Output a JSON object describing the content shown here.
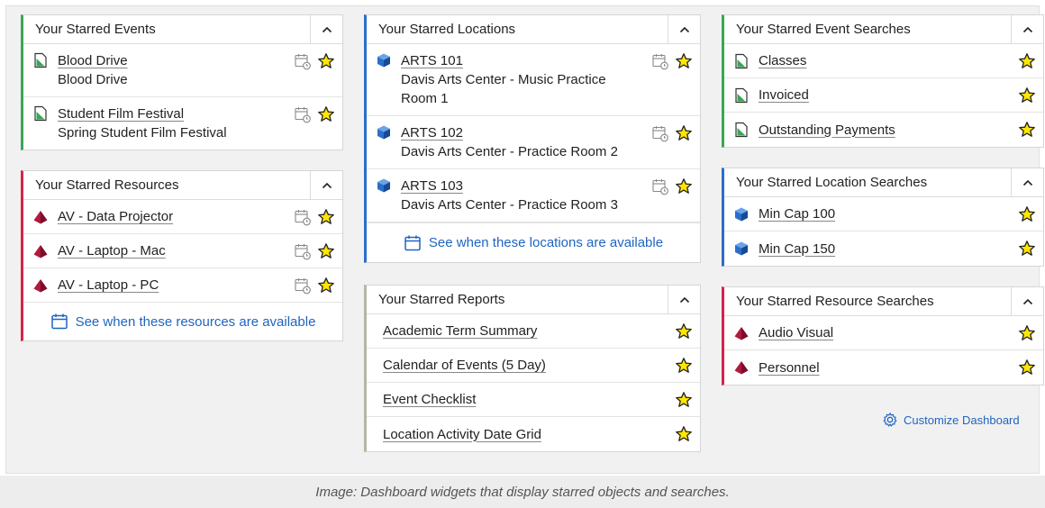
{
  "starred_events": {
    "title": "Your Starred Events",
    "items": [
      {
        "name": "Blood Drive",
        "sub": "Blood Drive"
      },
      {
        "name": "Student Film Festival",
        "sub": "Spring Student Film Festival"
      }
    ]
  },
  "starred_resources": {
    "title": "Your Starred Resources",
    "items": [
      {
        "name": "AV - Data Projector"
      },
      {
        "name": "AV - Laptop - Mac"
      },
      {
        "name": "AV - Laptop - PC"
      }
    ],
    "availability_link": "See when these resources are available"
  },
  "starred_locations": {
    "title": "Your Starred Locations",
    "items": [
      {
        "name": "ARTS 101",
        "sub": "Davis Arts Center - Music Practice Room 1"
      },
      {
        "name": "ARTS 102",
        "sub": "Davis Arts Center - Practice Room 2"
      },
      {
        "name": "ARTS 103",
        "sub": "Davis Arts Center - Practice Room 3"
      }
    ],
    "availability_link": "See when these locations are available"
  },
  "starred_reports": {
    "title": "Your Starred Reports",
    "items": [
      {
        "name": "Academic Term Summary"
      },
      {
        "name": "Calendar of Events (5 Day)"
      },
      {
        "name": "Event Checklist"
      },
      {
        "name": "Location Activity Date Grid"
      }
    ]
  },
  "starred_event_searches": {
    "title": "Your Starred Event Searches",
    "items": [
      {
        "name": "Classes"
      },
      {
        "name": "Invoiced"
      },
      {
        "name": "Outstanding Payments"
      }
    ]
  },
  "starred_location_searches": {
    "title": "Your Starred Location Searches",
    "items": [
      {
        "name": "Min Cap 100"
      },
      {
        "name": "Min Cap 150"
      }
    ]
  },
  "starred_resource_searches": {
    "title": "Your Starred Resource Searches",
    "items": [
      {
        "name": "Audio Visual"
      },
      {
        "name": "Personnel"
      }
    ]
  },
  "customize_label": "Customize Dashboard",
  "caption": "Image: Dashboard widgets that display starred objects and searches.",
  "colors": {
    "event": "#3aa655",
    "resource": "#d6234a",
    "location": "#2a6fc9",
    "report": "#b5b5a5",
    "link": "#1f65c1",
    "star_fill": "#ffe600"
  },
  "icons": {
    "event": "event-document-icon",
    "resource": "resource-pyramid-icon",
    "location": "location-cube-icon",
    "calendar": "calendar-clock-icon",
    "star": "star-icon",
    "collapse": "chevron-up-icon",
    "gear": "gear-icon"
  }
}
